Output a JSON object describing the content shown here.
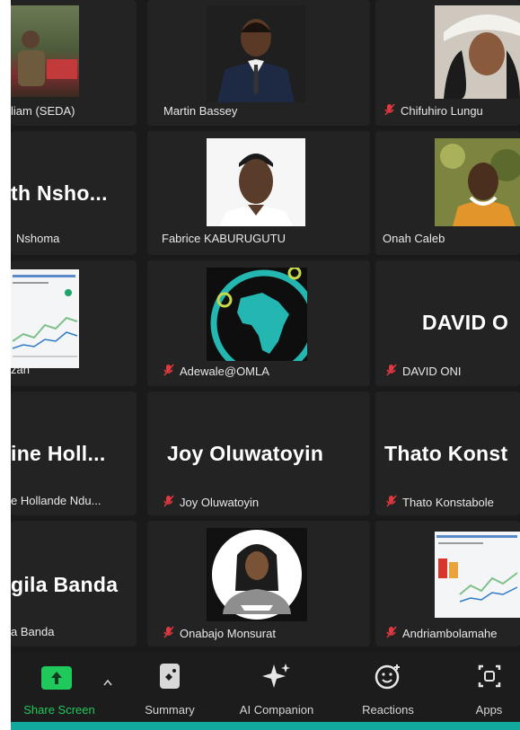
{
  "participants": [
    {
      "label": "liam (SEDA)",
      "muted": false
    },
    {
      "label": "Martin Bassey",
      "muted": false
    },
    {
      "label": "Chifuhiro Lungu",
      "muted": true
    },
    {
      "big": "th  Nsho...",
      "label": "Nshoma",
      "muted": false
    },
    {
      "label": "Fabrice KABURUGUTU",
      "muted": false
    },
    {
      "label": "Onah Caleb",
      "muted": false
    },
    {
      "label": "zan",
      "muted": false
    },
    {
      "label": "Adewale@OMLA",
      "muted": true
    },
    {
      "big": "DAVID O",
      "label": "DAVID ONI",
      "muted": true
    },
    {
      "big": "ine  Holl...",
      "label": "e Hollande Ndu...",
      "muted": false
    },
    {
      "big": "Joy Oluwatoyin",
      "label": "Joy Oluwatoyin",
      "muted": true
    },
    {
      "big": "Thato Konst",
      "label": "Thato Konstabole",
      "muted": true
    },
    {
      "big": "gila Banda",
      "label": "a Banda",
      "muted": false
    },
    {
      "label": "Onabajo Monsurat",
      "muted": true
    },
    {
      "label": "Andriambolamahe",
      "muted": true
    }
  ],
  "toolbar": {
    "share_screen": "Share Screen",
    "summary": "Summary",
    "ai_companion": "AI Companion",
    "reactions": "Reactions",
    "apps": "Apps"
  },
  "colors": {
    "share_green": "#20c95b",
    "muted_red": "#e0383e",
    "accent_teal": "#13a89e"
  }
}
